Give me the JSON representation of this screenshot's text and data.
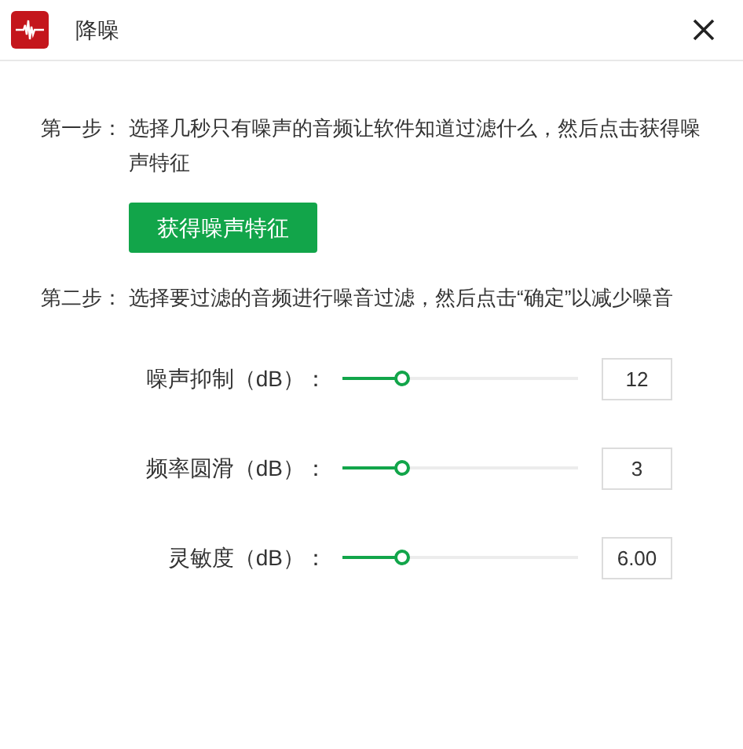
{
  "window": {
    "title": "降噪"
  },
  "steps": [
    {
      "label": "第一步：",
      "text": "选择几秒只有噪声的音频让软件知道过滤什么，然后点击获得噪声特征",
      "button": "获得噪声特征"
    },
    {
      "label": "第二步：",
      "text": "选择要过滤的音频进行噪音过滤，然后点击“确定”以减少噪音"
    }
  ],
  "sliders": [
    {
      "label": "噪声抑制（dB）：",
      "level": 0.25,
      "value": "12"
    },
    {
      "label": "频率圆滑（dB）：",
      "level": 0.25,
      "value": "3"
    },
    {
      "label": "灵敏度（dB）：",
      "level": 0.25,
      "value": "6.00"
    }
  ]
}
